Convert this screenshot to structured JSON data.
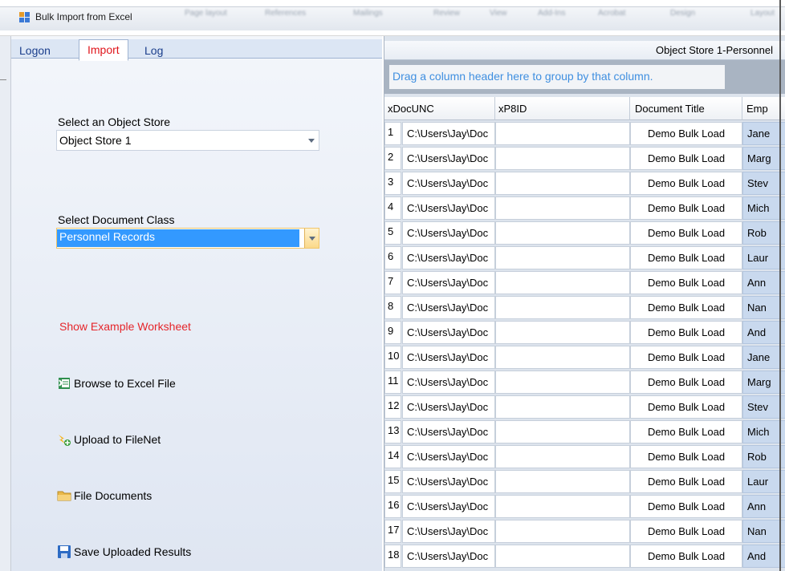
{
  "window": {
    "title": "Bulk Import from Excel",
    "background_tabs": [
      "Page layout",
      "References",
      "Mailings",
      "Review",
      "View",
      "Add-Ins",
      "Acrobat",
      "Design",
      "Layout"
    ]
  },
  "tabs": [
    {
      "label": "Logon"
    },
    {
      "label": "Import"
    },
    {
      "label": "Log"
    }
  ],
  "import": {
    "object_store_label": "Select an Object Store",
    "object_store_value": "Object Store 1",
    "doc_class_label": "Select Document Class",
    "doc_class_value": "Personnel Records",
    "show_example": "Show Example Worksheet",
    "browse": "Browse to Excel File",
    "upload": "Upload to FileNet",
    "file_docs": "File Documents",
    "save_results": "Save Uploaded Results"
  },
  "grid": {
    "caption": "Object Store 1-Personnel",
    "group_hint": "Drag a column header here to group by that column.",
    "columns": [
      "xDocUNC",
      "xP8ID",
      "Document Title",
      "Emp"
    ],
    "rows": [
      {
        "n": "1",
        "unc": "C:\\Users\\Jay\\Doc",
        "id": "",
        "title": "Demo Bulk Load",
        "emp": "Jane"
      },
      {
        "n": "2",
        "unc": "C:\\Users\\Jay\\Doc",
        "id": "",
        "title": "Demo Bulk Load",
        "emp": "Marg"
      },
      {
        "n": "3",
        "unc": "C:\\Users\\Jay\\Doc",
        "id": "",
        "title": "Demo Bulk Load",
        "emp": "Stev"
      },
      {
        "n": "4",
        "unc": "C:\\Users\\Jay\\Doc",
        "id": "",
        "title": "Demo Bulk Load",
        "emp": "Mich"
      },
      {
        "n": "5",
        "unc": "C:\\Users\\Jay\\Doc",
        "id": "",
        "title": "Demo Bulk Load",
        "emp": "Rob"
      },
      {
        "n": "6",
        "unc": "C:\\Users\\Jay\\Doc",
        "id": "",
        "title": "Demo Bulk Load",
        "emp": "Laur"
      },
      {
        "n": "7",
        "unc": "C:\\Users\\Jay\\Doc",
        "id": "",
        "title": "Demo Bulk Load",
        "emp": "Ann"
      },
      {
        "n": "8",
        "unc": "C:\\Users\\Jay\\Doc",
        "id": "",
        "title": "Demo Bulk Load",
        "emp": "Nan"
      },
      {
        "n": "9",
        "unc": "C:\\Users\\Jay\\Doc",
        "id": "",
        "title": "Demo Bulk Load",
        "emp": "And"
      },
      {
        "n": "10",
        "unc": "C:\\Users\\Jay\\Doc",
        "id": "",
        "title": "Demo Bulk Load",
        "emp": "Jane"
      },
      {
        "n": "11",
        "unc": "C:\\Users\\Jay\\Doc",
        "id": "",
        "title": "Demo Bulk Load",
        "emp": "Marg"
      },
      {
        "n": "12",
        "unc": "C:\\Users\\Jay\\Doc",
        "id": "",
        "title": "Demo Bulk Load",
        "emp": "Stev"
      },
      {
        "n": "13",
        "unc": "C:\\Users\\Jay\\Doc",
        "id": "",
        "title": "Demo Bulk Load",
        "emp": "Mich"
      },
      {
        "n": "14",
        "unc": "C:\\Users\\Jay\\Doc",
        "id": "",
        "title": "Demo Bulk Load",
        "emp": "Rob"
      },
      {
        "n": "15",
        "unc": "C:\\Users\\Jay\\Doc",
        "id": "",
        "title": "Demo Bulk Load",
        "emp": "Laur"
      },
      {
        "n": "16",
        "unc": "C:\\Users\\Jay\\Doc",
        "id": "",
        "title": "Demo Bulk Load",
        "emp": "Ann"
      },
      {
        "n": "17",
        "unc": "C:\\Users\\Jay\\Doc",
        "id": "",
        "title": "Demo Bulk Load",
        "emp": "Nan"
      },
      {
        "n": "18",
        "unc": "C:\\Users\\Jay\\Doc",
        "id": "",
        "title": "Demo Bulk Load",
        "emp": "And"
      }
    ]
  },
  "colors": {
    "active_tab_text": "#e0151b",
    "link_text": "#e5262b",
    "selection": "#3399ff",
    "group_hint_text": "#3f8fe0"
  },
  "icons": [
    "app-icon",
    "excel-icon",
    "upload-icon",
    "folder-icon",
    "save-icon",
    "chevron-down-icon"
  ]
}
